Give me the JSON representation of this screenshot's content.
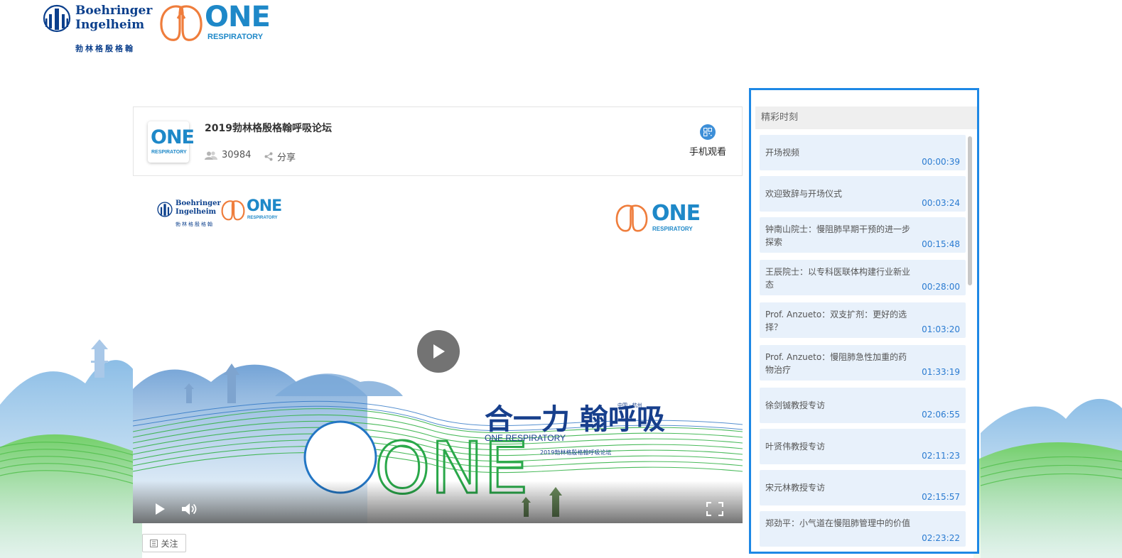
{
  "brand": {
    "company_name": "Boehringer\nIngelheim",
    "company_cn": "勃林格殷格翰",
    "one_word": "ONE",
    "respiratory_word": "RESPIRATORY"
  },
  "event": {
    "title": "2019勃林格殷格翰呼吸论坛",
    "viewers": "30984",
    "share_label": "分享",
    "mobile_watch_label": "手机观看",
    "follow_label": "关注"
  },
  "banner": {
    "slogan": "合一力 翰呼吸",
    "slogan_en": "ONE RESPIRATORY",
    "location": "中国 · 杭州",
    "forum_cn": "2019勃林格殷格翰呼吸论坛",
    "big_word": "ONE"
  },
  "highlights": {
    "header": "精彩时刻",
    "items": [
      {
        "title": "开场视频",
        "time": "00:00:39"
      },
      {
        "title": "欢迎致辞与开场仪式",
        "time": "00:03:24"
      },
      {
        "title": "钟南山院士：慢阻肺早期干预的进一步探索",
        "time": "00:15:48"
      },
      {
        "title": "王辰院士：以专科医联体构建行业新业态",
        "time": "00:28:00"
      },
      {
        "title": "Prof. Anzueto：双支扩剂：更好的选择？",
        "time": "01:03:20"
      },
      {
        "title": "Prof. Anzueto：慢阻肺急性加重的药物治疗",
        "time": "01:33:19"
      },
      {
        "title": "徐剑铖教授专访",
        "time": "02:06:55"
      },
      {
        "title": "叶贤伟教授专访",
        "time": "02:11:23"
      },
      {
        "title": "宋元林教授专访",
        "time": "02:15:57"
      },
      {
        "title": "郑劲平：小气道在慢阻肺管理中的价值",
        "time": "02:23:22"
      }
    ]
  },
  "colors": {
    "accent_blue": "#1e88e5",
    "brand_orange": "#ef7d3c",
    "brand_blue": "#1e88c8",
    "bi_navy": "#0b3f8c",
    "time_blue": "#2a7bd1",
    "item_bg": "#e8f1fb"
  },
  "icons": [
    "users-icon",
    "share-icon",
    "qr-code-icon",
    "play-icon",
    "volume-icon",
    "fullscreen-icon",
    "follow-icon"
  ]
}
